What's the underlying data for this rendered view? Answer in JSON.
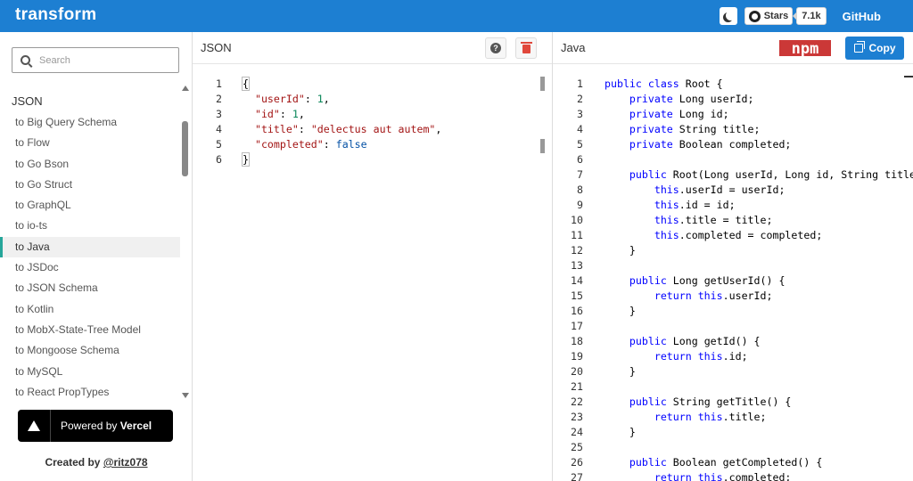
{
  "header": {
    "brand": "transform",
    "stars_label": "Stars",
    "stars_count": "7.1k",
    "github_label": "GitHub",
    "accent_color": "#1d7fd2",
    "theme_icon": "moon-icon"
  },
  "sidebar": {
    "search_placeholder": "Search",
    "heading": "JSON",
    "items": [
      {
        "label": "to Big Query Schema"
      },
      {
        "label": "to Flow"
      },
      {
        "label": "to Go Bson"
      },
      {
        "label": "to Go Struct"
      },
      {
        "label": "to GraphQL"
      },
      {
        "label": "to io-ts"
      },
      {
        "label": "to Java",
        "active": true
      },
      {
        "label": "to JSDoc"
      },
      {
        "label": "to JSON Schema"
      },
      {
        "label": "to Kotlin"
      },
      {
        "label": "to MobX-State-Tree Model"
      },
      {
        "label": "to Mongoose Schema"
      },
      {
        "label": "to MySQL"
      },
      {
        "label": "to React PropTypes"
      }
    ],
    "vercel_prefix": "Powered by",
    "vercel_brand": "Vercel",
    "created_by_prefix": "Created by",
    "created_by_handle": "@ritz078"
  },
  "json_panel": {
    "title": "JSON",
    "lines": [
      [
        [
          "{",
          "plain"
        ]
      ],
      [
        [
          "  ",
          "plain"
        ],
        [
          "\"userId\"",
          "key"
        ],
        [
          ": ",
          "plain"
        ],
        [
          "1",
          "num"
        ],
        [
          ",",
          "plain"
        ]
      ],
      [
        [
          "  ",
          "plain"
        ],
        [
          "\"id\"",
          "key"
        ],
        [
          ": ",
          "plain"
        ],
        [
          "1",
          "num"
        ],
        [
          ",",
          "plain"
        ]
      ],
      [
        [
          "  ",
          "plain"
        ],
        [
          "\"title\"",
          "key"
        ],
        [
          ": ",
          "plain"
        ],
        [
          "\"delectus aut autem\"",
          "str"
        ],
        [
          ",",
          "plain"
        ]
      ],
      [
        [
          "  ",
          "plain"
        ],
        [
          "\"completed\"",
          "key"
        ],
        [
          ": ",
          "plain"
        ],
        [
          "false",
          "bool"
        ]
      ],
      [
        [
          "}",
          "plain"
        ]
      ]
    ]
  },
  "java_panel": {
    "title": "Java",
    "copy_label": "Copy",
    "npm_logo_text": "npm",
    "lines": [
      [
        [
          "public class",
          "kw"
        ],
        [
          " Root {",
          "plain"
        ]
      ],
      [
        [
          "    private",
          "kw"
        ],
        [
          " Long userId;",
          "plain"
        ]
      ],
      [
        [
          "    private",
          "kw"
        ],
        [
          " Long id;",
          "plain"
        ]
      ],
      [
        [
          "    private",
          "kw"
        ],
        [
          " String title;",
          "plain"
        ]
      ],
      [
        [
          "    private",
          "kw"
        ],
        [
          " Boolean completed;",
          "plain"
        ]
      ],
      [],
      [
        [
          "    public",
          "kw"
        ],
        [
          " Root(Long userId, Long id, String title",
          "plain"
        ]
      ],
      [
        [
          "        this",
          "kw"
        ],
        [
          ".userId = userId;",
          "plain"
        ]
      ],
      [
        [
          "        this",
          "kw"
        ],
        [
          ".id = id;",
          "plain"
        ]
      ],
      [
        [
          "        this",
          "kw"
        ],
        [
          ".title = title;",
          "plain"
        ]
      ],
      [
        [
          "        this",
          "kw"
        ],
        [
          ".completed = completed;",
          "plain"
        ]
      ],
      [
        [
          "    }",
          "plain"
        ]
      ],
      [],
      [
        [
          "    public",
          "kw"
        ],
        [
          " Long getUserId() {",
          "plain"
        ]
      ],
      [
        [
          "        return this",
          "kw"
        ],
        [
          ".userId;",
          "plain"
        ]
      ],
      [
        [
          "    }",
          "plain"
        ]
      ],
      [],
      [
        [
          "    public",
          "kw"
        ],
        [
          " Long getId() {",
          "plain"
        ]
      ],
      [
        [
          "        return this",
          "kw"
        ],
        [
          ".id;",
          "plain"
        ]
      ],
      [
        [
          "    }",
          "plain"
        ]
      ],
      [],
      [
        [
          "    public",
          "kw"
        ],
        [
          " String getTitle() {",
          "plain"
        ]
      ],
      [
        [
          "        return this",
          "kw"
        ],
        [
          ".title;",
          "plain"
        ]
      ],
      [
        [
          "    }",
          "plain"
        ]
      ],
      [],
      [
        [
          "    public",
          "kw"
        ],
        [
          " Boolean getCompleted() {",
          "plain"
        ]
      ],
      [
        [
          "        return this",
          "kw"
        ],
        [
          ".completed;",
          "plain"
        ]
      ]
    ]
  }
}
